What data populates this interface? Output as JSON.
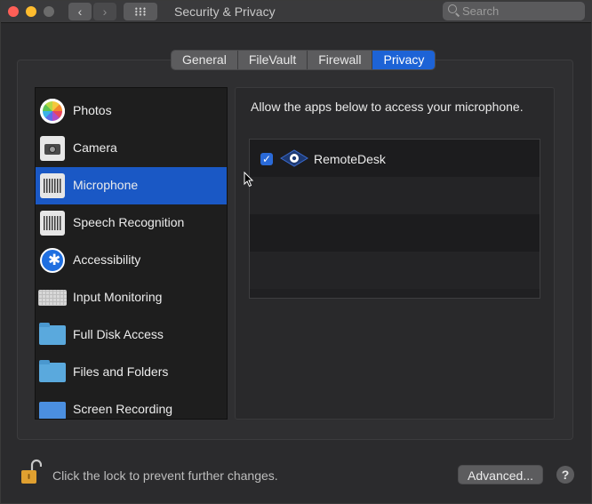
{
  "window": {
    "title": "Security & Privacy",
    "search_placeholder": "Search",
    "nav_back": "‹",
    "nav_forward": "›"
  },
  "tabs": [
    {
      "label": "General",
      "active": false
    },
    {
      "label": "FileVault",
      "active": false
    },
    {
      "label": "Firewall",
      "active": false
    },
    {
      "label": "Privacy",
      "active": true
    }
  ],
  "sidebar": {
    "items": [
      {
        "label": "Photos",
        "icon": "photos-icon",
        "selected": false
      },
      {
        "label": "Camera",
        "icon": "camera-icon",
        "selected": false
      },
      {
        "label": "Microphone",
        "icon": "microphone-waveform-icon",
        "selected": true
      },
      {
        "label": "Speech Recognition",
        "icon": "speech-waveform-icon",
        "selected": false
      },
      {
        "label": "Accessibility",
        "icon": "accessibility-icon",
        "selected": false
      },
      {
        "label": "Input Monitoring",
        "icon": "keyboard-icon",
        "selected": false
      },
      {
        "label": "Full Disk Access",
        "icon": "folder-icon",
        "selected": false
      },
      {
        "label": "Files and Folders",
        "icon": "folder-icon",
        "selected": false
      },
      {
        "label": "Screen Recording",
        "icon": "screen-icon",
        "selected": false
      }
    ]
  },
  "main": {
    "heading": "Allow the apps below to access your microphone.",
    "apps": [
      {
        "name": "RemoteDesk",
        "checked": true,
        "icon": "remotedesk-eye-icon"
      }
    ]
  },
  "footer": {
    "lock_text": "Click the lock to prevent further changes.",
    "advanced_label": "Advanced...",
    "help_label": "?"
  },
  "colors": {
    "accent": "#1d63d6",
    "selection": "#1a58c5",
    "window_bg": "#2b2b2d"
  }
}
